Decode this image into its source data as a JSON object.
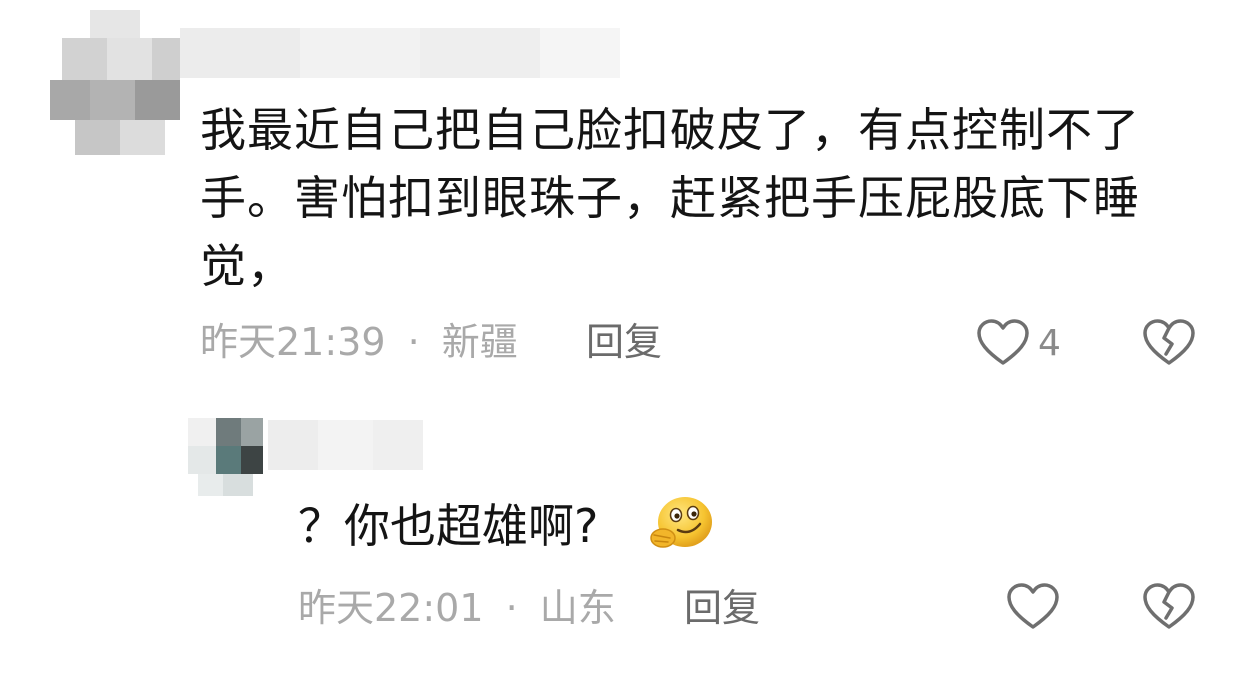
{
  "comment": {
    "text": "我最近自己把自己脸扣破皮了，有点控制不了手。害怕扣到眼珠子，赶紧把手压屁股底下睡觉，",
    "time": "昨天21:39",
    "separator": "·",
    "location": "新疆",
    "reply_label": "回复",
    "like_count": "4",
    "like_icon": "heart-outline-icon",
    "dislike_icon": "broken-heart-icon"
  },
  "reply": {
    "text": "？你也超雄啊?",
    "emoji": "sly-grin-emoji",
    "time": "昨天22:01",
    "separator": "·",
    "location": "山东",
    "reply_label": "回复",
    "like_icon": "heart-outline-icon",
    "dislike_icon": "broken-heart-icon"
  }
}
